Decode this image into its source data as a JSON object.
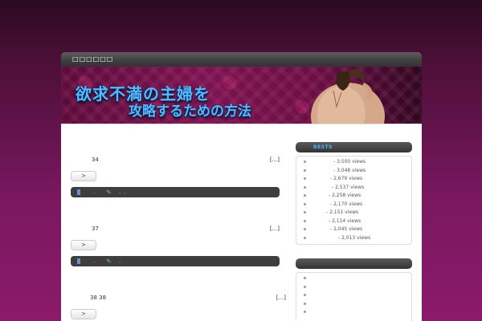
{
  "header": {
    "title": "□□□□□□"
  },
  "banner": {
    "line1": "欲求不満の主婦を",
    "line2": "攻略するための方法"
  },
  "posts": [
    {
      "meta": "34",
      "more": "[...]",
      "button": ">",
      "bar_dot1": ".",
      "bar_dot2": ".",
      "bar_dot3": "."
    },
    {
      "meta": "37",
      "more": "[...]",
      "button": ">",
      "bar_dot1": ".",
      "bar_dot2": ".",
      "bar_dot3": ""
    },
    {
      "meta": "38 38",
      "more": "[...]",
      "button": ">",
      "bar_dot1": "",
      "bar_dot2": "",
      "bar_dot3": ""
    }
  ],
  "sidebar": {
    "bests": {
      "title": "BESTS",
      "items": [
        "- 3,500 views",
        "- 3,048 views",
        "- 2,679 views",
        "- 2,537 views",
        "- 2,258 views",
        "- 2,170 views",
        "- 2,151 views",
        "- 2,114 views",
        "- 2,045 views",
        "- 2,013 views"
      ]
    },
    "widget2": {
      "title": ""
    }
  },
  "colors": {
    "accent": "#4fb3ff",
    "background_dark": "#2b0a20",
    "background_light": "#8b1a6b"
  }
}
